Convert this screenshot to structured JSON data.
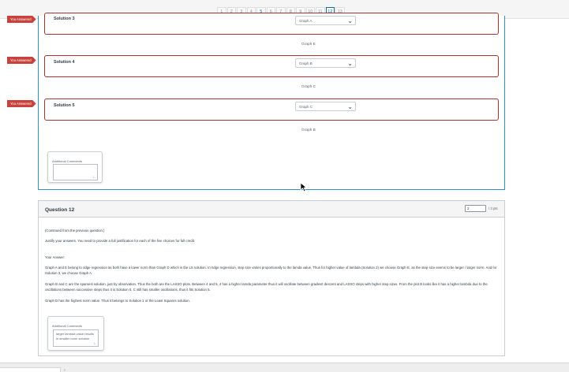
{
  "pagination": {
    "pages": [
      "1",
      "2",
      "3",
      "4",
      "5",
      "6",
      "7",
      "8",
      "9",
      "10",
      "11",
      "12",
      "13"
    ],
    "active_page": "12"
  },
  "solutions": [
    {
      "badge": "You Answered",
      "title": "Solution 3",
      "selected": "Graph A",
      "answer": "Graph E"
    },
    {
      "badge": "You Answered",
      "title": "Solution 4",
      "selected": "Graph B",
      "answer": "Graph C"
    },
    {
      "badge": "You Answered",
      "title": "Solution 5",
      "selected": "Graph C",
      "answer": "Graph B"
    }
  ],
  "comments_label": "Additional Comments",
  "question": {
    "title": "Question 12",
    "score_value": "2",
    "points_total": "/ 3 pts",
    "paragraphs": [
      "(Continued from the previous question.)",
      "Justify your answers.  You need to provide a full justification for each of the five choices for full credit.",
      "Your Answer:",
      "Graph A and E belong to ridge regression as both have a lower norm than Graph D which is the LS solution. In ridge regression, step size varies proportionally to the lamda value. Thus for higher value of lambda (Solution 2) we choose Graph E, as the step size seems to be larger / larger norm. And for Solution 3, we choose Graph A.",
      "Graph B and C are the sparsest solution, just by observation. Thus the both are the LASSO plots. Between 4 and 5, 4 has a higher lamda parameter thus it will oscillate between gradient descent and LASSO steps with higher step sizes. From the plot B looks like it has a higher lambda due to the oscillations between successive steps thus it is Solution 5. C still has smaller oscillations, thus it fits Solution 5.",
      "Graph D has the highest norm value. Thus it belongs to Solution 1 or the Least Squares solution."
    ],
    "comment_text": "larger lambda value results in smaller norm solution"
  }
}
